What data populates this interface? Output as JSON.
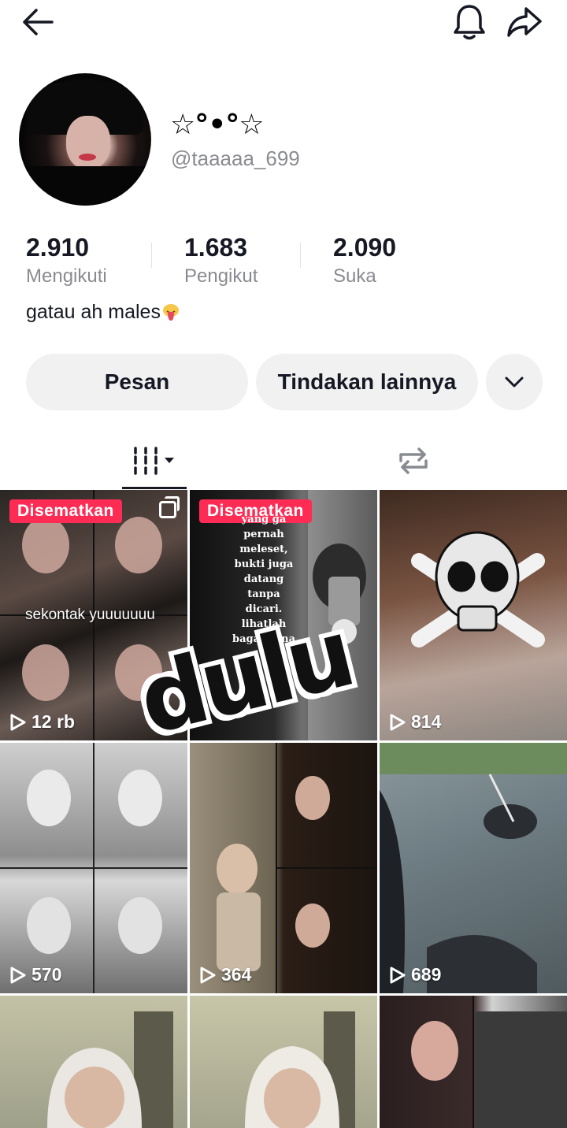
{
  "header": {
    "back_icon": "arrow-left-icon",
    "bell_icon": "bell-icon",
    "share_icon": "share-arrow-icon"
  },
  "profile": {
    "display_name": "☆°•°☆",
    "handle": "@taaaaa_699",
    "bio": "gatau ah males",
    "bio_emoji": "tongue-emoji"
  },
  "stats": [
    {
      "value": "2.910",
      "label": "Mengikuti"
    },
    {
      "value": "1.683",
      "label": "Pengikut"
    },
    {
      "value": "2.090",
      "label": "Suka"
    }
  ],
  "actions": {
    "message": "Pesan",
    "more": "Tindakan lainnya",
    "dropdown_icon": "chevron-down-icon"
  },
  "tabs": {
    "videos_icon": "grid-videos-icon",
    "repost_icon": "repost-icon"
  },
  "videos": [
    {
      "pinned_label": "Disematkan",
      "views": "12 rb",
      "caption": "sekontak yuuuuuuu",
      "multi": true
    },
    {
      "pinned_label": "Disematkan",
      "views": "",
      "quote": "yang ga pernah meleset, bukti juga datang tanpa dicari. lihatlah bagaimana"
    },
    {
      "views": "814"
    },
    {
      "views": "570"
    },
    {
      "views": "364"
    },
    {
      "views": "689"
    },
    {
      "views": ""
    },
    {
      "views": ""
    },
    {
      "views": ""
    }
  ],
  "sticker_text": "dulu",
  "colors": {
    "accent": "#fe2c55",
    "text": "#161823",
    "muted": "#8a8b91",
    "button_bg": "#f1f1f2"
  }
}
